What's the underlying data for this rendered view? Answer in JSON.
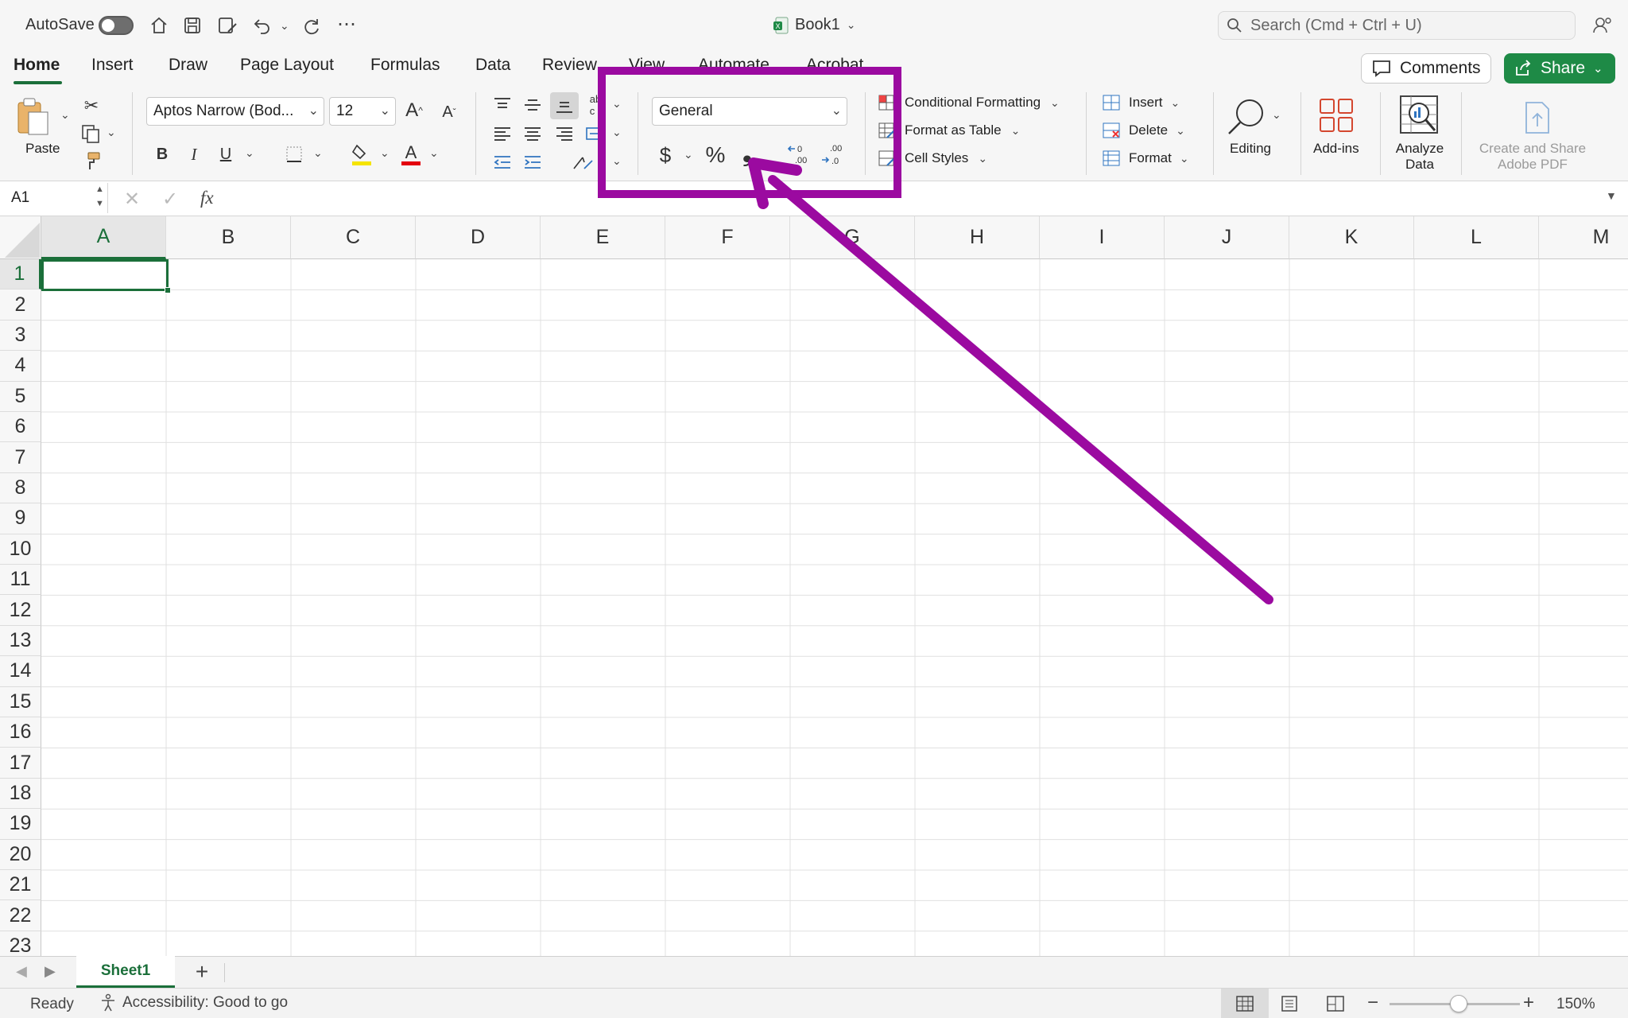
{
  "titlebar": {
    "autosave_label": "AutoSave",
    "doc_title": "Book1",
    "search_placeholder": "Search (Cmd + Ctrl + U)",
    "comments_label": "Comments",
    "share_label": "Share"
  },
  "tabs": [
    {
      "label": "Home",
      "active": true
    },
    {
      "label": "Insert"
    },
    {
      "label": "Draw"
    },
    {
      "label": "Page Layout"
    },
    {
      "label": "Formulas"
    },
    {
      "label": "Data"
    },
    {
      "label": "Review"
    },
    {
      "label": "View"
    },
    {
      "label": "Automate"
    },
    {
      "label": "Acrobat"
    }
  ],
  "ribbon": {
    "paste_label": "Paste",
    "font_name": "Aptos Narrow (Bod...",
    "font_size": "12",
    "bold": "B",
    "italic": "I",
    "underline": "U",
    "number_format": "General",
    "currency": "$",
    "percent": "%",
    "comma": "❟",
    "conditional_formatting": "Conditional Formatting",
    "format_as_table": "Format as Table",
    "cell_styles": "Cell Styles",
    "insert": "Insert",
    "delete": "Delete",
    "format": "Format",
    "editing": "Editing",
    "addins": "Add-ins",
    "analyze_data_1": "Analyze",
    "analyze_data_2": "Data",
    "adobe_pdf_1": "Create and Share",
    "adobe_pdf_2": "Adobe PDF"
  },
  "formula_bar": {
    "name_box": "A1",
    "fx": "fx"
  },
  "grid": {
    "columns": [
      "A",
      "B",
      "C",
      "D",
      "E",
      "F",
      "G",
      "H",
      "I",
      "J",
      "K",
      "L",
      "M"
    ],
    "rows": [
      "1",
      "2",
      "3",
      "4",
      "5",
      "6",
      "7",
      "8",
      "9",
      "10",
      "11",
      "12",
      "13",
      "14",
      "15",
      "16",
      "17",
      "18",
      "19",
      "20",
      "21",
      "22",
      "23"
    ],
    "selected_cell": "A1"
  },
  "sheets": {
    "active": "Sheet1",
    "add": "+"
  },
  "status": {
    "ready": "Ready",
    "accessibility": "Accessibility: Good to go",
    "zoom": "150%",
    "zoom_minus": "−",
    "zoom_plus": "+"
  },
  "annotation": {
    "color": "#9b0aa0"
  },
  "colors": {
    "accent_green": "#1b6f3a",
    "share_green": "#1e8a46"
  }
}
